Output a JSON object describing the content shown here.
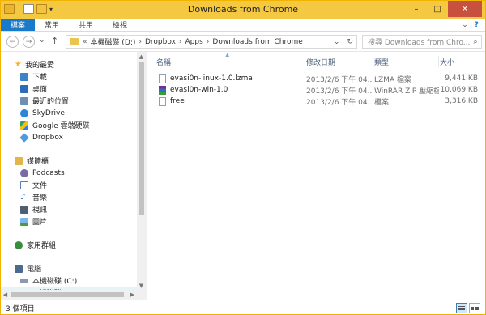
{
  "window": {
    "title": "Downloads from Chrome",
    "controls": {
      "minimize": "–",
      "maximize": "□",
      "close": "✕"
    }
  },
  "ribbon": {
    "tabs": [
      "檔案",
      "常用",
      "共用",
      "檢視"
    ],
    "collapse_glyph": "⌄",
    "help_glyph": "?"
  },
  "nav": {
    "back": "←",
    "forward": "→",
    "recent": "⌄",
    "up": "↑",
    "breadcrumb": {
      "lead": "«",
      "items": [
        "本機磁碟 (D:)",
        "Dropbox",
        "Apps",
        "Downloads from Chrome"
      ],
      "dropdown": "⌄",
      "refresh": "↻"
    },
    "search": {
      "placeholder": "搜尋 Downloads from Chro...",
      "icon_glyph": "⌕"
    }
  },
  "navpane": {
    "groups": [
      {
        "label": "我的最愛",
        "icon": "star-icon",
        "color": "#f3b12e",
        "children": [
          {
            "label": "下載",
            "icon": "download-folder-icon",
            "color": "#3e83c6"
          },
          {
            "label": "桌面",
            "icon": "desktop-icon",
            "color": "#2a6fb5"
          },
          {
            "label": "最近的位置",
            "icon": "recent-places-icon",
            "color": "#6c8fb3"
          },
          {
            "label": "SkyDrive",
            "icon": "skydrive-icon",
            "color": "#2e84d6"
          },
          {
            "label": "Google 雲端硬碟",
            "icon": "google-drive-icon",
            "color": "#2fa35f"
          },
          {
            "label": "Dropbox",
            "icon": "dropbox-icon",
            "color": "#4c9be0"
          }
        ]
      },
      {
        "label": "媒體櫃",
        "icon": "libraries-icon",
        "color": "#e2b44c",
        "children": [
          {
            "label": "Podcasts",
            "icon": "podcasts-icon",
            "color": "#7a6aa8"
          },
          {
            "label": "文件",
            "icon": "documents-icon",
            "color": "#5b7db0"
          },
          {
            "label": "音樂",
            "icon": "music-icon",
            "color": "#2c78c9"
          },
          {
            "label": "視訊",
            "icon": "videos-icon",
            "color": "#4f5e73"
          },
          {
            "label": "圖片",
            "icon": "pictures-icon",
            "color": "#3a8fcf"
          }
        ]
      },
      {
        "label": "家用群組",
        "icon": "homegroup-icon",
        "color": "#3b8d3d",
        "children": []
      },
      {
        "label": "電腦",
        "icon": "computer-icon",
        "color": "#4a6a8e",
        "children": [
          {
            "label": "本機磁碟 (C:)",
            "icon": "drive-c-icon",
            "color": "#8a99ab"
          },
          {
            "label": "本機磁碟 (D:)",
            "icon": "drive-d-icon",
            "color": "#8a99ab",
            "selected": true
          }
        ]
      }
    ]
  },
  "files": {
    "columns": [
      "名稱",
      "修改日期",
      "類型",
      "大小"
    ],
    "rows": [
      {
        "name": "evasi0n-linux-1.0.lzma",
        "date": "2013/2/6 下午 04...",
        "type": "LZMA 檔案",
        "size": "9,441 KB",
        "icon": "generic-file-icon"
      },
      {
        "name": "evasi0n-win-1.0",
        "date": "2013/2/6 下午 04...",
        "type": "WinRAR ZIP 壓縮檔",
        "size": "10,069 KB",
        "icon": "winrar-archive-icon"
      },
      {
        "name": "free",
        "date": "2013/2/6 下午 04...",
        "type": "檔案",
        "size": "3,316 KB",
        "icon": "generic-file-icon"
      }
    ]
  },
  "status": {
    "item_count": "3 個項目"
  }
}
